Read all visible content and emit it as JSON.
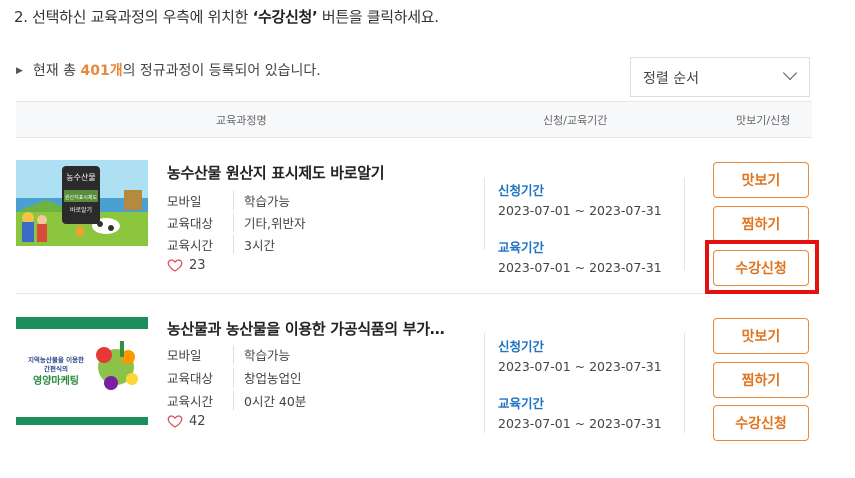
{
  "instruction": {
    "prefix": "2. 선택하신 교육과정의 우측에 위치한 ",
    "highlight": "‘수강신청’",
    "suffix": " 버튼을 클릭하세요."
  },
  "summary": {
    "prefix": "현재 총 ",
    "count": "401개",
    "suffix": "의 정규과정이 등록되어 있습니다."
  },
  "sort": {
    "label": "정렬 순서"
  },
  "table_header": {
    "course_name": "교육과정명",
    "period": "신청/교육기간",
    "actions": "맛보기/신청"
  },
  "courses": [
    {
      "title": "농수산물 원산지 표시제도 바로알기",
      "thumb_text": [
        "농수산물",
        "원산지표시제도",
        "바로알기"
      ],
      "mobile_label": "모바일",
      "mobile_value": "학습가능",
      "target_label": "교육대상",
      "target_value": "기타,위반자",
      "time_label": "교육시간",
      "time_value": "3시간",
      "likes": "23",
      "apply_label": "신청기간",
      "apply_period": "2023-07-01 ~ 2023-07-31",
      "edu_label": "교육기간",
      "edu_period": "2023-07-01 ~ 2023-07-31",
      "btn_preview": "맛보기",
      "btn_wish": "찜하기",
      "btn_enroll": "수강신청"
    },
    {
      "title": "농산물과 농산물을 이용한 가공식품의 부가…",
      "thumb_text": [
        "지역농산물을 이용한",
        "간편식의",
        "영양마케팅"
      ],
      "mobile_label": "모바일",
      "mobile_value": "학습가능",
      "target_label": "교육대상",
      "target_value": "창업농업인",
      "time_label": "교육시간",
      "time_value": "0시간 40분",
      "likes": "42",
      "apply_label": "신청기간",
      "apply_period": "2023-07-01 ~ 2023-07-31",
      "edu_label": "교육기간",
      "edu_period": "2023-07-01 ~ 2023-07-31",
      "btn_preview": "맛보기",
      "btn_wish": "찜하기",
      "btn_enroll": "수강신청"
    }
  ],
  "colors": {
    "accent": "#e8883a",
    "link_blue": "#1f73c4",
    "highlight_red": "#e41010"
  }
}
